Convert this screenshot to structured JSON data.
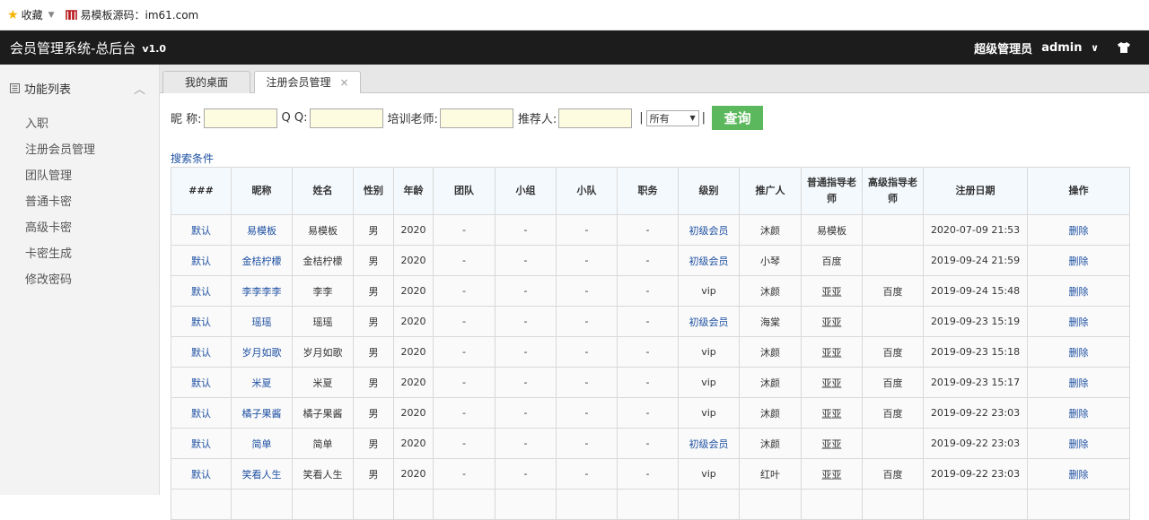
{
  "browser": {
    "bookmark_fav": "收藏",
    "bookmark_site": "易模板源码：im61.com"
  },
  "app": {
    "title": "会员管理系统-总后台",
    "version": "v1.0",
    "role": "超级管理员",
    "user": "admin"
  },
  "sidebar": {
    "header": "功能列表",
    "items": [
      "入职",
      "注册会员管理",
      "团队管理",
      "普通卡密",
      "高级卡密",
      "卡密生成",
      "修改密码"
    ]
  },
  "tabs": [
    {
      "label": "我的桌面"
    },
    {
      "label": "注册会员管理",
      "close": "×"
    }
  ],
  "filter": {
    "nickname_label": "昵 称:",
    "qq_label": "Q Q:",
    "trainer_label": "培训老师:",
    "referrer_label": "推荐人:",
    "select_value": "所有",
    "query_button": "查询",
    "search_conditions": "搜索条件"
  },
  "table": {
    "headers": [
      "###",
      "昵称",
      "姓名",
      "性别",
      "年龄",
      "团队",
      "小组",
      "小队",
      "职务",
      "级别",
      "推广人",
      "普通指导老师",
      "高级指导老师",
      "注册日期",
      "操作"
    ],
    "rows": [
      [
        "默认",
        "易模板",
        "易模板",
        "男",
        "2020",
        "-",
        "-",
        "-",
        "-",
        "初级会员",
        "沐颜",
        "易模板",
        "",
        "2020-07-09 21:53",
        "删除"
      ],
      [
        "默认",
        "金桔柠檬",
        "金桔柠檬",
        "男",
        "2020",
        "-",
        "-",
        "-",
        "-",
        "初级会员",
        "小琴",
        "百度",
        "",
        "2019-09-24 21:59",
        "删除"
      ],
      [
        "默认",
        "李李李李",
        "李李",
        "男",
        "2020",
        "-",
        "-",
        "-",
        "-",
        "vip",
        "沐颜",
        "亚亚",
        "百度",
        "2019-09-24 15:48",
        "删除"
      ],
      [
        "默认",
        "瑶瑶",
        "瑶瑶",
        "男",
        "2020",
        "-",
        "-",
        "-",
        "-",
        "初级会员",
        "海棠",
        "亚亚",
        "",
        "2019-09-23 15:19",
        "删除"
      ],
      [
        "默认",
        "岁月如歌",
        "岁月如歌",
        "男",
        "2020",
        "-",
        "-",
        "-",
        "-",
        "vip",
        "沐颜",
        "亚亚",
        "百度",
        "2019-09-23 15:18",
        "删除"
      ],
      [
        "默认",
        "米夏",
        "米夏",
        "男",
        "2020",
        "-",
        "-",
        "-",
        "-",
        "vip",
        "沐颜",
        "亚亚",
        "百度",
        "2019-09-23 15:17",
        "删除"
      ],
      [
        "默认",
        "橘子果酱",
        "橘子果酱",
        "男",
        "2020",
        "-",
        "-",
        "-",
        "-",
        "vip",
        "沐颜",
        "亚亚",
        "百度",
        "2019-09-22 23:03",
        "删除"
      ],
      [
        "默认",
        "简单",
        "简单",
        "男",
        "2020",
        "-",
        "-",
        "-",
        "-",
        "初级会员",
        "沐颜",
        "亚亚",
        "",
        "2019-09-22 23:03",
        "删除"
      ],
      [
        "默认",
        "笑看人生",
        "笑看人生",
        "男",
        "2020",
        "-",
        "-",
        "-",
        "-",
        "vip",
        "红叶",
        "亚亚",
        "百度",
        "2019-09-22 23:03",
        "删除"
      ],
      [
        "",
        "",
        "",
        "",
        "",
        "",
        "",
        "",
        "",
        "",
        "",
        "",
        "",
        "",
        ""
      ]
    ]
  },
  "colors": {
    "topbar": "#1c1c1c",
    "link": "#1e50a2",
    "query_button": "#5cb85c",
    "header_bg": "#f4f9fd",
    "input_bg": "#fdfbe0"
  }
}
